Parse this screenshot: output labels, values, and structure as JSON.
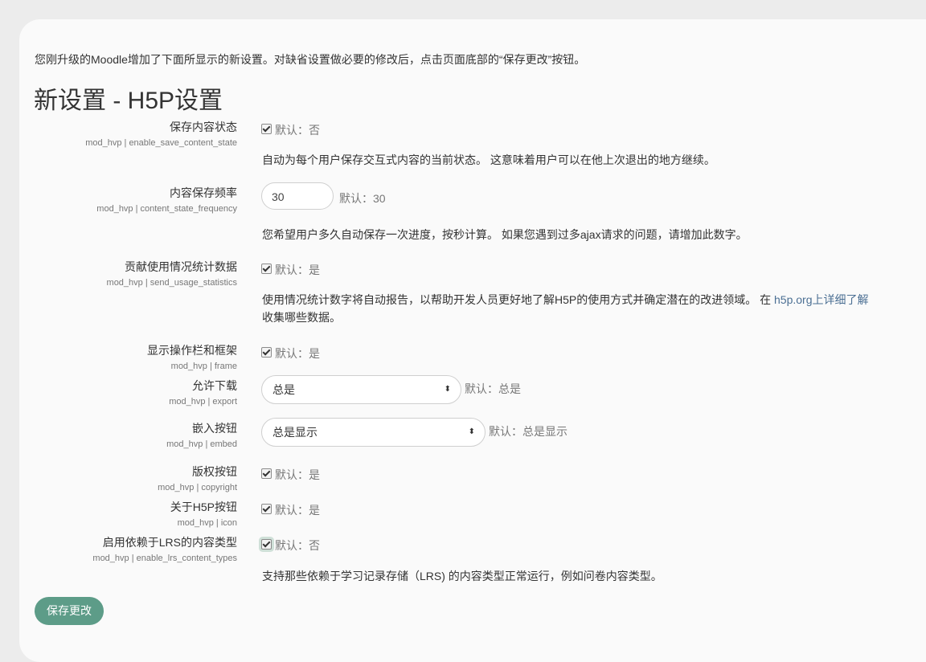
{
  "intro": "您刚升级的Moodle增加了下面所显示的新设置。对缺省设置做必要的修改后，点击页面底部的“保存更改”按钮。",
  "heading": "新设置 - H5P设置",
  "settings": {
    "save_state": {
      "label": "保存内容状态",
      "key": "mod_hvp | enable_save_content_state",
      "checked": true,
      "default": "默认：否",
      "desc": "自动为每个用户保存交互式内容的当前状态。 这意味着用户可以在他上次退出的地方继续。"
    },
    "frequency": {
      "label": "内容保存频率",
      "key": "mod_hvp | content_state_frequency",
      "value": "30",
      "default": "默认：30",
      "desc": "您希望用户多久自动保存一次进度，按秒计算。 如果您遇到过多ajax请求的问题，请增加此数字。"
    },
    "usage": {
      "label": "贡献使用情况统计数据",
      "key": "mod_hvp | send_usage_statistics",
      "checked": true,
      "default": "默认：是",
      "desc_line1": "使用情况统计数字将自动报告，以帮助开发人员更好地了解H5P的使用方式并确定潜在的改进领域。 在 ",
      "desc_link": "h5p.org上详细了解",
      "desc_line2": "收集哪些数据。"
    },
    "frame": {
      "label": "显示操作栏和框架",
      "key": "mod_hvp | frame",
      "checked": true,
      "default": "默认：是"
    },
    "export": {
      "label": "允许下载",
      "key": "mod_hvp | export",
      "selected": "总是",
      "default": "默认：总是"
    },
    "embed": {
      "label": "嵌入按钮",
      "key": "mod_hvp | embed",
      "selected": "总是显示",
      "default": "默认：总是显示"
    },
    "copyright": {
      "label": "版权按钮",
      "key": "mod_hvp | copyright",
      "checked": true,
      "default": "默认：是"
    },
    "icon": {
      "label": "关于H5P按钮",
      "key": "mod_hvp | icon",
      "checked": true,
      "default": "默认：是"
    },
    "lrs": {
      "label": "启用依赖于LRS的内容类型",
      "key": "mod_hvp | enable_lrs_content_types",
      "checked": true,
      "default": "默认：否",
      "desc": "支持那些依赖于学习记录存储（LRS) 的内容类型正常运行，例如问卷内容类型。"
    }
  },
  "save_button": "保存更改",
  "accent_color": "#5d9c88"
}
